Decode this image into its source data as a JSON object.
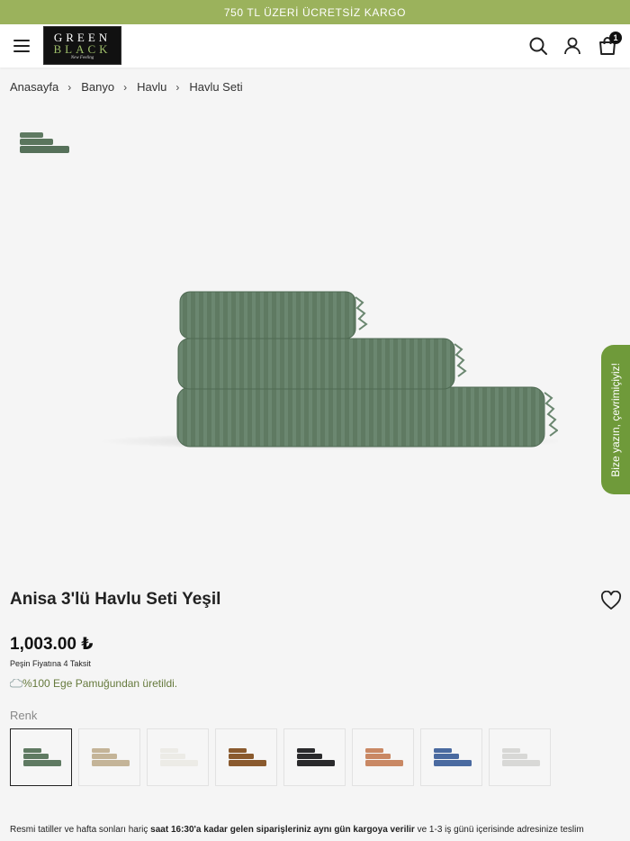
{
  "promo_bar": {
    "text": "750 TL ÜZERİ ÜCRETSİZ KARGO"
  },
  "header": {
    "logo": {
      "line1": "GREEN",
      "line2": "BLACK",
      "tagline": "New Feeling"
    },
    "cart_count": "1"
  },
  "breadcrumb": [
    "Anasayfa",
    "Banyo",
    "Havlu",
    "Havlu Seti"
  ],
  "chat_button": {
    "label": "Bize yazın, çevrimiçiyiz!"
  },
  "product": {
    "title": "Anisa 3'lü Havlu Seti Yeşil",
    "price": "1,003.00 ₺",
    "installment_note": "Peşin Fiyatına 4 Taksit",
    "material_note": "%100 Ege Pamuğundan üretildi.",
    "color_label": "Renk",
    "main_color": "#5f7a62",
    "swatches": [
      {
        "color": "#5f7a62",
        "selected": true
      },
      {
        "color": "#c4b498",
        "selected": false
      },
      {
        "color": "#ecebe6",
        "selected": false
      },
      {
        "color": "#8a5a2e",
        "selected": false
      },
      {
        "color": "#2a2a2c",
        "selected": false
      },
      {
        "color": "#c98864",
        "selected": false
      },
      {
        "color": "#4a6aa0",
        "selected": false
      },
      {
        "color": "#d8d8d6",
        "selected": false
      }
    ]
  },
  "delivery": {
    "part1": "Resmi tatiller ve hafta sonları hariç ",
    "part2": "saat 16:30'a kadar gelen siparişleriniz aynı gün kargoya verilir",
    "part3": " ve 1-3 iş günü içerisinde adresinize teslim"
  },
  "colors": {
    "accent": "#9bb25c",
    "chat": "#6f9a3a"
  }
}
